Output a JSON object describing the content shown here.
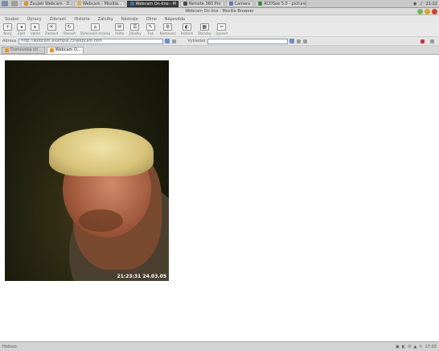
{
  "taskbar": {
    "tasks": [
      {
        "label": "Zaujati Webcam - D...",
        "color": "#d7902a"
      },
      {
        "label": "Webcam - Mozilla...",
        "color": "#e0b040"
      },
      {
        "label": "Webcam On-line - M",
        "color": "#3a6fb0"
      },
      {
        "label": "Remote 360 Pro",
        "color": "#4a4a4a"
      },
      {
        "label": "Camera",
        "color": "#5a7fb0"
      },
      {
        "label": "ACDSee 5.0 - picture",
        "color": "#3d8a3d"
      }
    ],
    "tray_time": "21:22"
  },
  "window": {
    "title": "Webcam On-line - Mozilla Browser"
  },
  "menu": [
    "Soubor",
    "Úpravy",
    "Zobrazit",
    "Historie",
    "Záložky",
    "Nástroje",
    "Okno",
    "Nápověda"
  ],
  "toolbar": [
    {
      "icon": "+",
      "label": "Nový"
    },
    {
      "icon": "◂",
      "label": "Zpět"
    },
    {
      "icon": "▸",
      "label": "Vpřed"
    },
    {
      "icon": "✕",
      "label": "Zastavit"
    },
    {
      "icon": "↻",
      "label": "Obnovit"
    },
    {
      "icon": "⌂",
      "label": "Domovská stránka"
    },
    {
      "icon": "✉",
      "label": "Pošta"
    },
    {
      "icon": "☰",
      "label": "Záložky"
    },
    {
      "icon": "✎",
      "label": "Tisk"
    },
    {
      "icon": "⚙",
      "label": "Nastavení"
    },
    {
      "icon": "◐",
      "label": "Historie"
    },
    {
      "icon": "▦",
      "label": "Obrázky"
    },
    {
      "icon": "✂",
      "label": "Upravit"
    }
  ],
  "address": {
    "label": "Adresa",
    "url": "http://webcam.example.cz/webcam.htm",
    "search_label": "Vyhledat",
    "search_value": ""
  },
  "tabs": [
    {
      "label": "Domovská str...",
      "active": false
    },
    {
      "label": "Webcam O...",
      "active": true
    }
  ],
  "content": {
    "webcam_timestamp": "21:23:31 24.03.05"
  },
  "statusbar": {
    "text": "Hotovo",
    "right_items": [
      "▣",
      "◧",
      "✉",
      "▲",
      "✎",
      "17:03"
    ]
  }
}
